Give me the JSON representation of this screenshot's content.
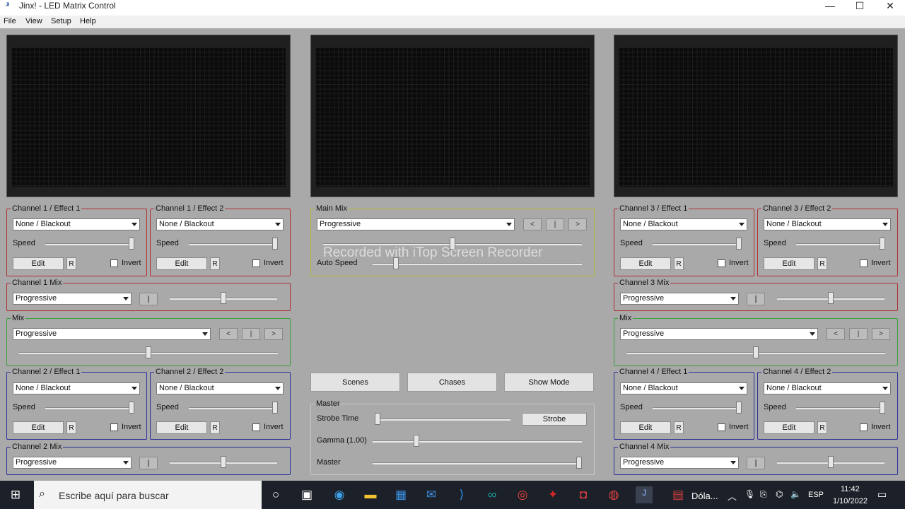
{
  "window": {
    "title": "Jinx! - LED Matrix Control",
    "app_icon": "jinx-logo",
    "controls": {
      "minimize": "—",
      "maximize": "☐",
      "close": "✕"
    }
  },
  "menu": [
    "File",
    "View",
    "Setup",
    "Help"
  ],
  "effects": {
    "ch1_e1": {
      "title": "Channel 1 / Effect 1",
      "value": "None / Blackout",
      "speed_label": "Speed",
      "edit": "Edit",
      "r": "R",
      "invert": "Invert",
      "speed": 1.0
    },
    "ch1_e2": {
      "title": "Channel 1 / Effect 2",
      "value": "None / Blackout",
      "speed_label": "Speed",
      "edit": "Edit",
      "r": "R",
      "invert": "Invert",
      "speed": 1.0
    },
    "ch2_e1": {
      "title": "Channel 2 / Effect 1",
      "value": "None / Blackout",
      "speed_label": "Speed",
      "edit": "Edit",
      "r": "R",
      "invert": "Invert",
      "speed": 1.0
    },
    "ch2_e2": {
      "title": "Channel 2 / Effect 2",
      "value": "None / Blackout",
      "speed_label": "Speed",
      "edit": "Edit",
      "r": "R",
      "invert": "Invert",
      "speed": 1.0
    },
    "ch3_e1": {
      "title": "Channel 3 / Effect 1",
      "value": "None / Blackout",
      "speed_label": "Speed",
      "edit": "Edit",
      "r": "R",
      "invert": "Invert",
      "speed": 1.0
    },
    "ch3_e2": {
      "title": "Channel 3 / Effect 2",
      "value": "None / Blackout",
      "speed_label": "Speed",
      "edit": "Edit",
      "r": "R",
      "invert": "Invert",
      "speed": 1.0
    },
    "ch4_e1": {
      "title": "Channel 4 / Effect 1",
      "value": "None / Blackout",
      "speed_label": "Speed",
      "edit": "Edit",
      "r": "R",
      "invert": "Invert",
      "speed": 1.0
    },
    "ch4_e2": {
      "title": "Channel 4 / Effect 2",
      "value": "None / Blackout",
      "speed_label": "Speed",
      "edit": "Edit",
      "r": "R",
      "invert": "Invert",
      "speed": 1.0
    }
  },
  "channel_mix": {
    "ch1": {
      "title": "Channel 1 Mix",
      "value": "Progressive",
      "btn": "|",
      "level": 0.5
    },
    "ch2": {
      "title": "Channel 2 Mix",
      "value": "Progressive",
      "btn": "|",
      "level": 0.5
    },
    "ch3": {
      "title": "Channel 3 Mix",
      "value": "Progressive",
      "btn": "|",
      "level": 0.5
    },
    "ch4": {
      "title": "Channel 4 Mix",
      "value": "Progressive",
      "btn": "|",
      "level": 0.5
    }
  },
  "mix": {
    "left": {
      "title": "Mix",
      "value": "Progressive",
      "prev": "<",
      "mid": "|",
      "next": ">",
      "level": 0.5
    },
    "right": {
      "title": "Mix",
      "value": "Progressive",
      "prev": "<",
      "mid": "|",
      "next": ">",
      "level": 0.5
    }
  },
  "main_mix": {
    "title": "Main Mix",
    "value": "Progressive",
    "prev": "<",
    "mid": "|",
    "next": ">",
    "auto_speed_label": "Auto Speed",
    "level": 0.5,
    "auto_speed": 0.1
  },
  "scene_buttons": [
    "Scenes",
    "Chases",
    "Show Mode"
  ],
  "master": {
    "title": "Master",
    "strobe_label": "Strobe Time",
    "strobe_button": "Strobe",
    "gamma_label": "Gamma (1.00)",
    "master_label": "Master",
    "strobe_time": 0.0,
    "gamma": 0.2,
    "master_level": 1.0
  },
  "watermark": "Recorded with iTop Screen Recorder",
  "taskbar": {
    "search_placeholder": "Escribe aquí para buscar",
    "weather": "Dóla...",
    "lang": "ESP",
    "time": "11:42",
    "date": "1/10/2022"
  }
}
